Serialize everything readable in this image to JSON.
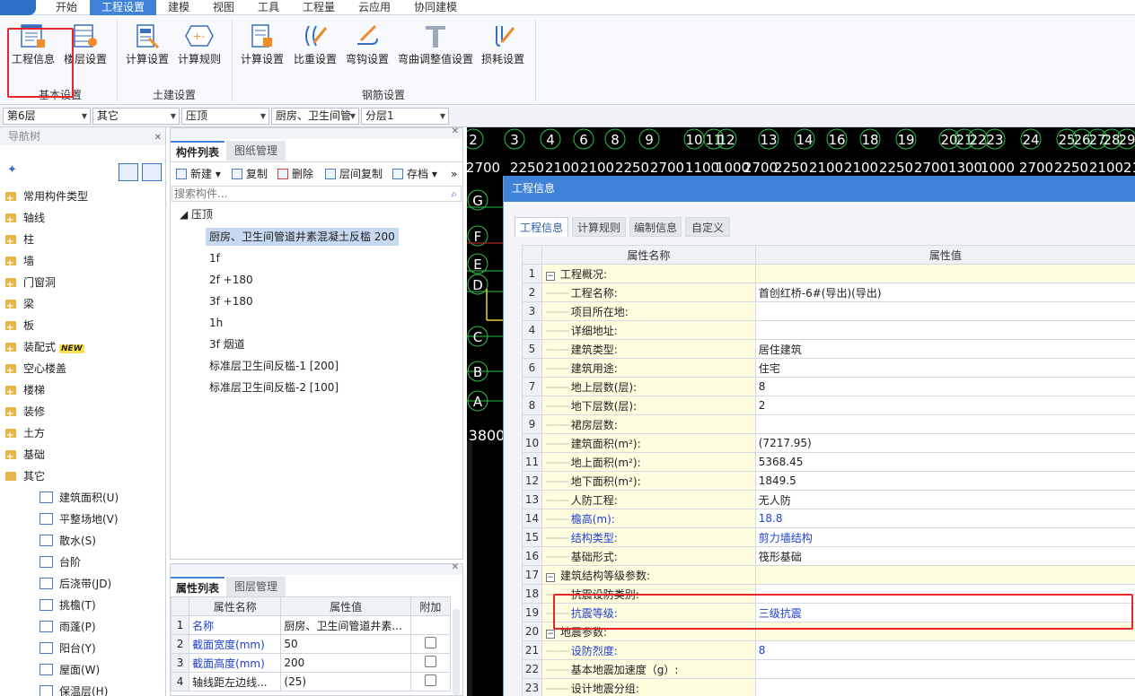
{
  "menu": {
    "items": [
      "开始",
      "工程设置",
      "建模",
      "视图",
      "工具",
      "工程量",
      "云应用",
      "协同建模"
    ],
    "active": "工程设置"
  },
  "ribbon": {
    "groups": [
      {
        "label": "基本设置",
        "buttons": [
          "工程信息",
          "楼层设置"
        ]
      },
      {
        "label": "土建设置",
        "buttons": [
          "计算设置",
          "计算规则"
        ]
      },
      {
        "label": "钢筋设置",
        "buttons": [
          "计算设置",
          "比重设置",
          "弯钩设置",
          "弯曲调整值设置",
          "损耗设置"
        ]
      }
    ]
  },
  "selectors": [
    "第6层",
    "其它",
    "压顶",
    "厨房、卫生间管",
    "分层1"
  ],
  "nav": {
    "title": "导航树",
    "items": [
      "常用构件类型",
      "轴线",
      "柱",
      "墙",
      "门窗洞",
      "梁",
      "板",
      "装配式",
      "空心楼盖",
      "楼梯",
      "装修",
      "土方",
      "基础",
      "其它"
    ],
    "new_badge": "NEW",
    "sub_items": [
      "建筑面积(U)",
      "平整场地(V)",
      "散水(S)",
      "台阶",
      "后浇带(JD)",
      "挑檐(T)",
      "雨蓬(P)",
      "阳台(Y)",
      "屋面(W)",
      "保温层(H)"
    ]
  },
  "component_list": {
    "tabs": [
      "构件列表",
      "图纸管理"
    ],
    "toolbar": [
      "新建",
      "复制",
      "删除",
      "层间复制",
      "存档"
    ],
    "search_placeholder": "搜索构件...",
    "root": "压顶",
    "items": [
      "厨房、卫生间管道井素混凝土反槛 200",
      "1f",
      "2f +180",
      "3f +180",
      "1h",
      "3f 烟道",
      "标准层卫生间反槛-1 [200]",
      "标准层卫生间反槛-2 [100]"
    ]
  },
  "attribute_list": {
    "tabs": [
      "属性列表",
      "图层管理"
    ],
    "headers": [
      "属性名称",
      "属性值",
      "附加"
    ],
    "rows": [
      {
        "n": "1",
        "name": "名称",
        "value": "厨房、卫生间管道井素..."
      },
      {
        "n": "2",
        "name": "截面宽度(mm)",
        "value": "50"
      },
      {
        "n": "3",
        "name": "截面高度(mm)",
        "value": "200"
      },
      {
        "n": "4",
        "name": "轴线距左边线...",
        "value": "(25)"
      }
    ]
  },
  "cad": {
    "axis_numbers": [
      "2",
      "3",
      "4",
      "6",
      "8",
      "9",
      "10",
      "11",
      "12",
      "13",
      "14",
      "16",
      "18",
      "19",
      "20",
      "21",
      "22",
      "23",
      "24",
      "25",
      "26",
      "27",
      "28",
      "29"
    ],
    "dims": [
      "2700",
      "2250",
      "2100",
      "2100",
      "2250",
      "2700",
      "1100",
      "1000",
      "2700",
      "2250",
      "2100",
      "2100",
      "2250",
      "2700",
      "1300",
      "1000",
      "2700",
      "2250",
      "2100",
      "2100"
    ],
    "row_labels": [
      "G",
      "F",
      "E",
      "D",
      "C",
      "B",
      "A"
    ],
    "bottom_dim": "3800"
  },
  "dialog": {
    "title": "工程信息",
    "tabs": [
      "工程信息",
      "计算规则",
      "编制信息",
      "自定义"
    ],
    "headers": [
      "属性名称",
      "属性值"
    ],
    "rows": [
      {
        "n": "1",
        "name": "工程概况:",
        "value": "",
        "group": true
      },
      {
        "n": "2",
        "name": "工程名称:",
        "value": "首创红桥-6#(导出)(导出)"
      },
      {
        "n": "3",
        "name": "项目所在地:",
        "value": ""
      },
      {
        "n": "4",
        "name": "详细地址:",
        "value": ""
      },
      {
        "n": "5",
        "name": "建筑类型:",
        "value": "居住建筑"
      },
      {
        "n": "6",
        "name": "建筑用途:",
        "value": "住宅"
      },
      {
        "n": "7",
        "name": "地上层数(层):",
        "value": "8"
      },
      {
        "n": "8",
        "name": "地下层数(层):",
        "value": "2"
      },
      {
        "n": "9",
        "name": "裙房层数:",
        "value": ""
      },
      {
        "n": "10",
        "name": "建筑面积(m²):",
        "value": "(7217.95)"
      },
      {
        "n": "11",
        "name": "地上面积(m²):",
        "value": "5368.45"
      },
      {
        "n": "12",
        "name": "地下面积(m²):",
        "value": "1849.5"
      },
      {
        "n": "13",
        "name": "人防工程:",
        "value": "无人防"
      },
      {
        "n": "14",
        "name": "檐高(m):",
        "value": "18.8",
        "blue": true
      },
      {
        "n": "15",
        "name": "结构类型:",
        "value": "剪力墙结构",
        "blue": true
      },
      {
        "n": "16",
        "name": "基础形式:",
        "value": "筏形基础"
      },
      {
        "n": "17",
        "name": "建筑结构等级参数:",
        "value": "",
        "group": true
      },
      {
        "n": "18",
        "name": "抗震设防类别:",
        "value": ""
      },
      {
        "n": "19",
        "name": "抗震等级:",
        "value": "三级抗震",
        "blue": true
      },
      {
        "n": "20",
        "name": "地震参数:",
        "value": "",
        "group": true
      },
      {
        "n": "21",
        "name": "设防烈度:",
        "value": "8",
        "blue": true
      },
      {
        "n": "22",
        "name": "基本地震加速度（g）:",
        "value": ""
      },
      {
        "n": "23",
        "name": "设计地震分组:",
        "value": ""
      }
    ]
  }
}
